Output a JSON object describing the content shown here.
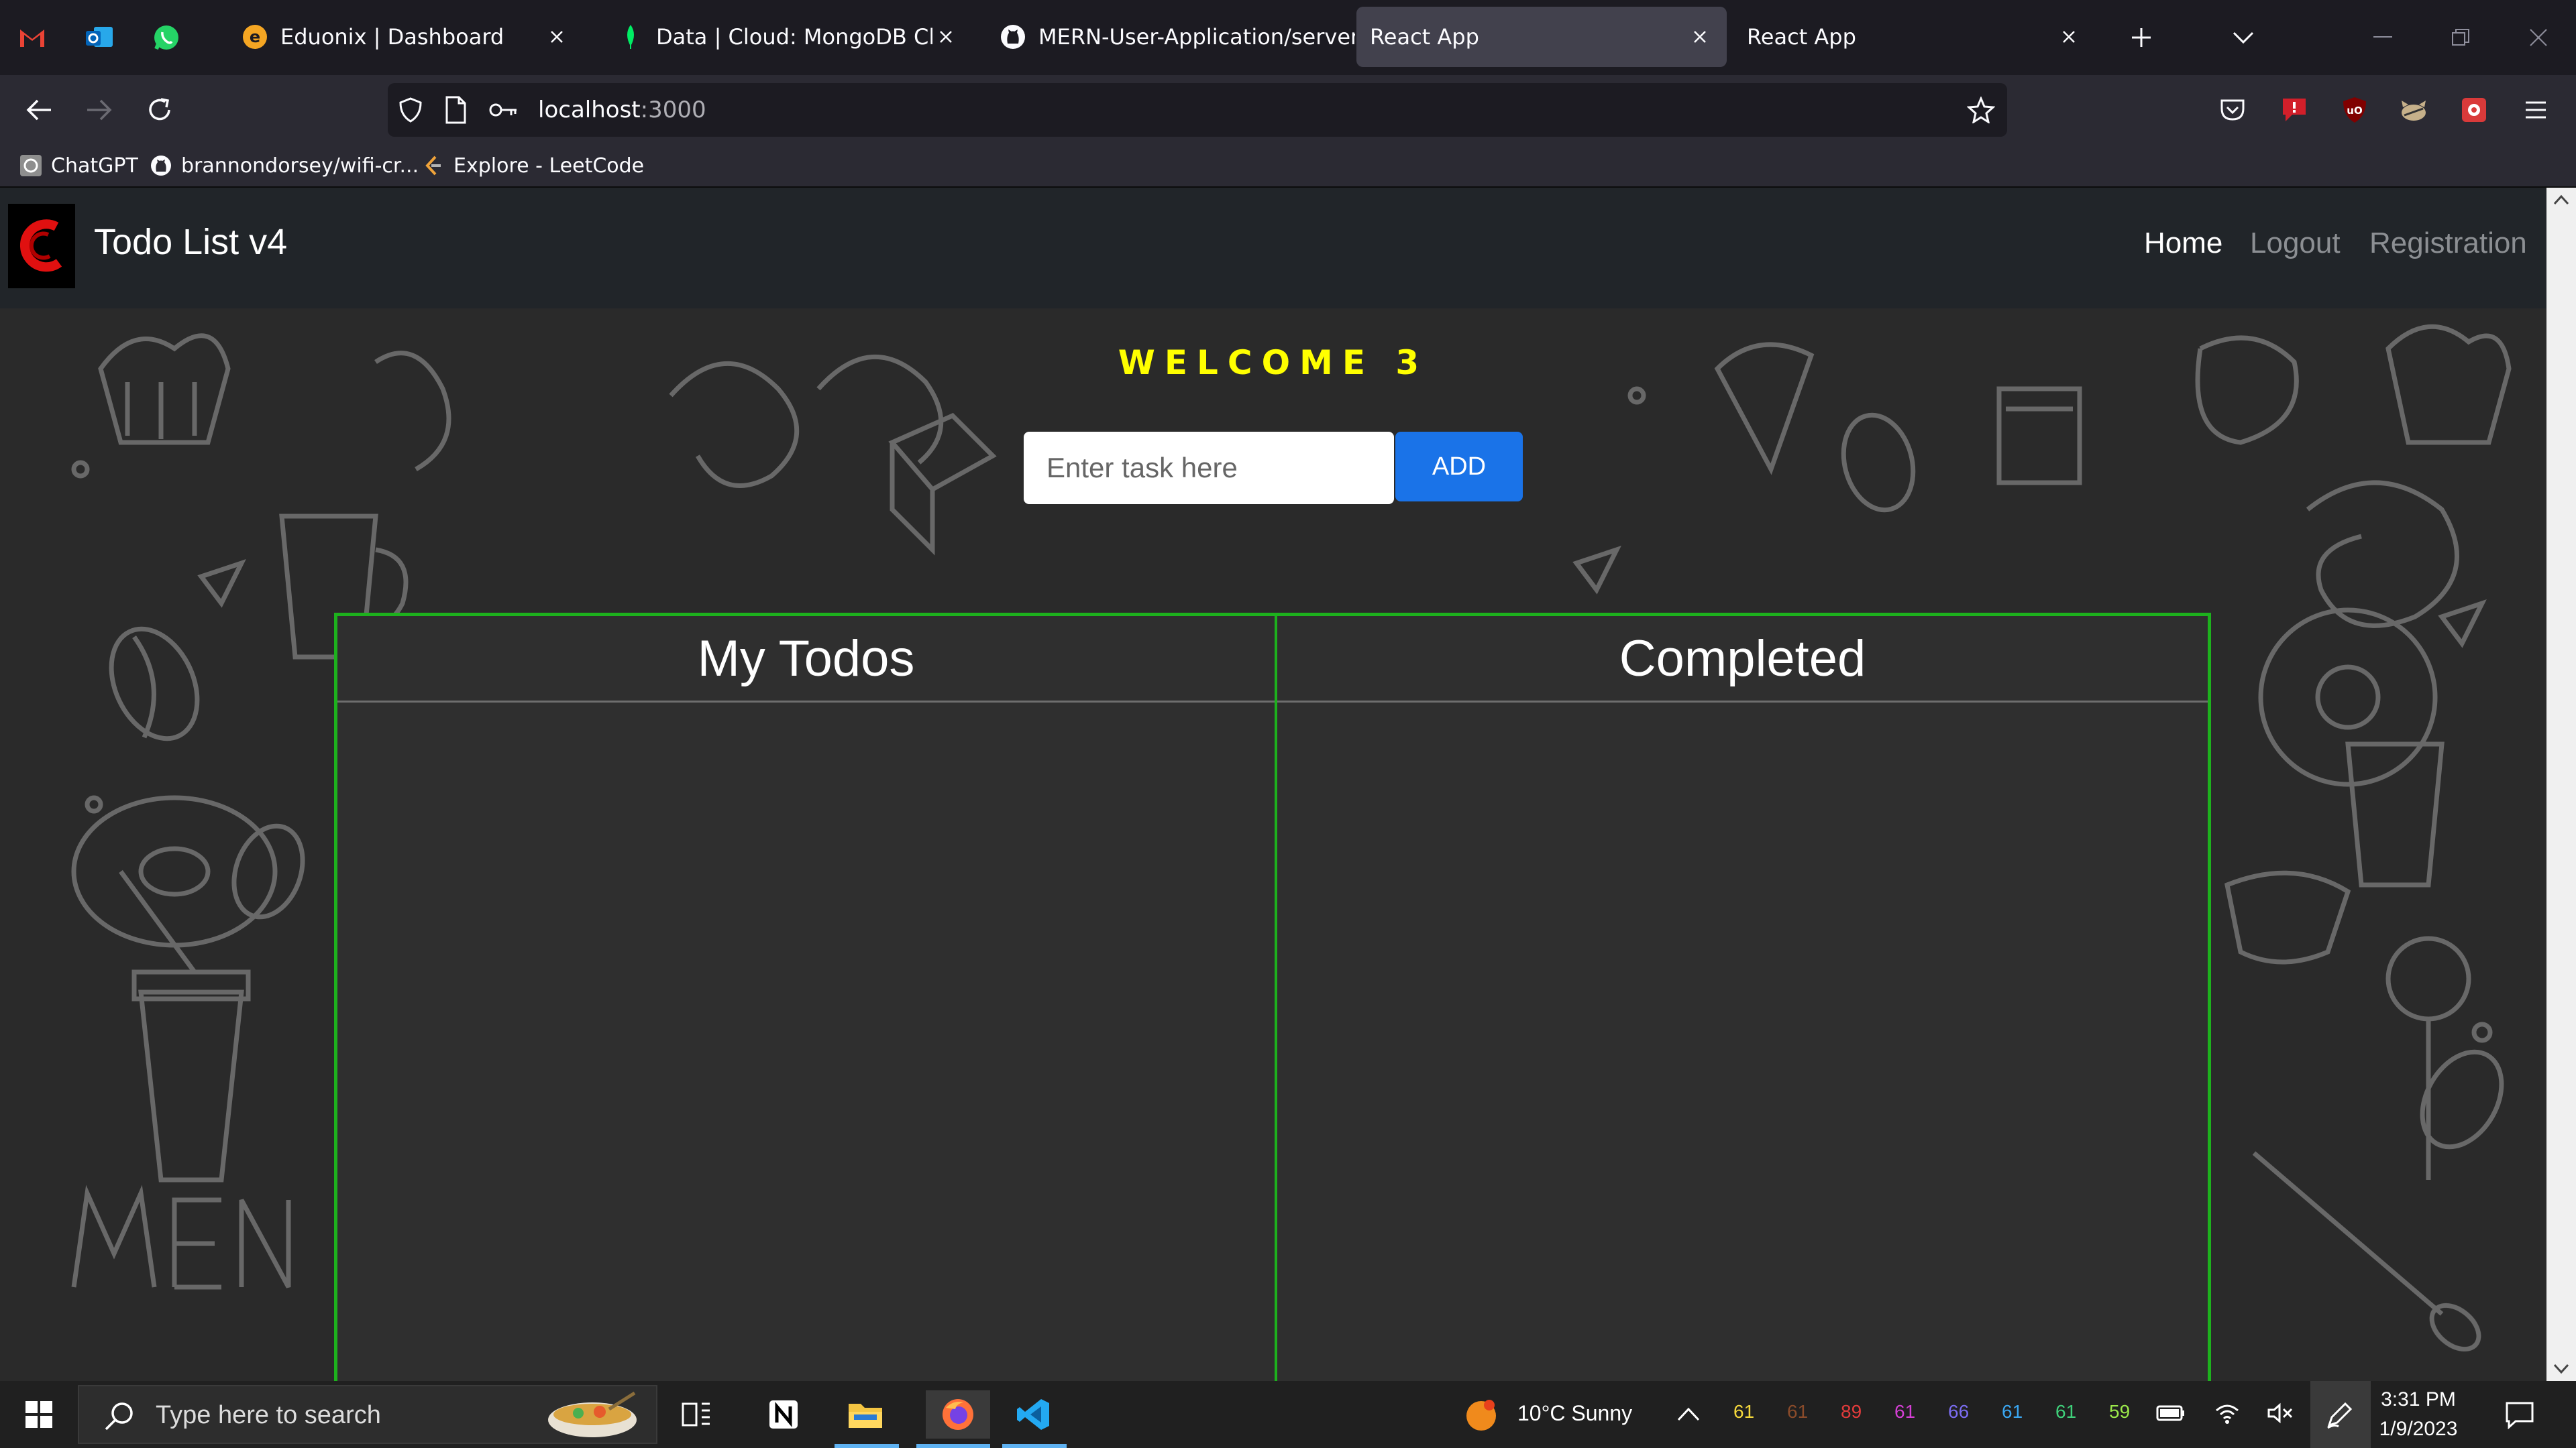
{
  "browser": {
    "tabs": [
      {
        "title": "Eduonix | Dashboard",
        "active": false
      },
      {
        "title": "Data | Cloud: MongoDB Cloud",
        "active": false
      },
      {
        "title": "MERN-User-Application/server",
        "active": false
      },
      {
        "title": "React App",
        "active": true
      },
      {
        "title": "React App",
        "active": false
      }
    ],
    "url_host": "localhost",
    "url_port": ":3000",
    "bookmarks": [
      "ChatGPT",
      "brannondorsey/wifi-cr...",
      "Explore - LeetCode"
    ]
  },
  "app": {
    "brand": "Todo List v4",
    "nav": [
      "Home",
      "Logout",
      "Registration"
    ],
    "welcome": "WELCOME 3",
    "input_placeholder": "Enter task here",
    "add_label": "ADD",
    "columns": [
      "My Todos",
      "Completed"
    ]
  },
  "taskbar": {
    "search_placeholder": "Type here to search",
    "weather": "10°C  Sunny",
    "tray_numbers": [
      {
        "value": "61",
        "color": "#f5d83b"
      },
      {
        "value": "61",
        "color": "#8a4b2a"
      },
      {
        "value": "89",
        "color": "#e23b3b"
      },
      {
        "value": "61",
        "color": "#d43fd4"
      },
      {
        "value": "66",
        "color": "#7b6cf0"
      },
      {
        "value": "61",
        "color": "#3aa6f0"
      },
      {
        "value": "61",
        "color": "#3fd07a"
      },
      {
        "value": "59",
        "color": "#9be84a"
      }
    ],
    "time": "3:31 PM",
    "date": "1/9/2023"
  },
  "colors": {
    "welcome": "#ffff00",
    "board_border": "#1db11d",
    "add_button": "#1a73e8"
  }
}
